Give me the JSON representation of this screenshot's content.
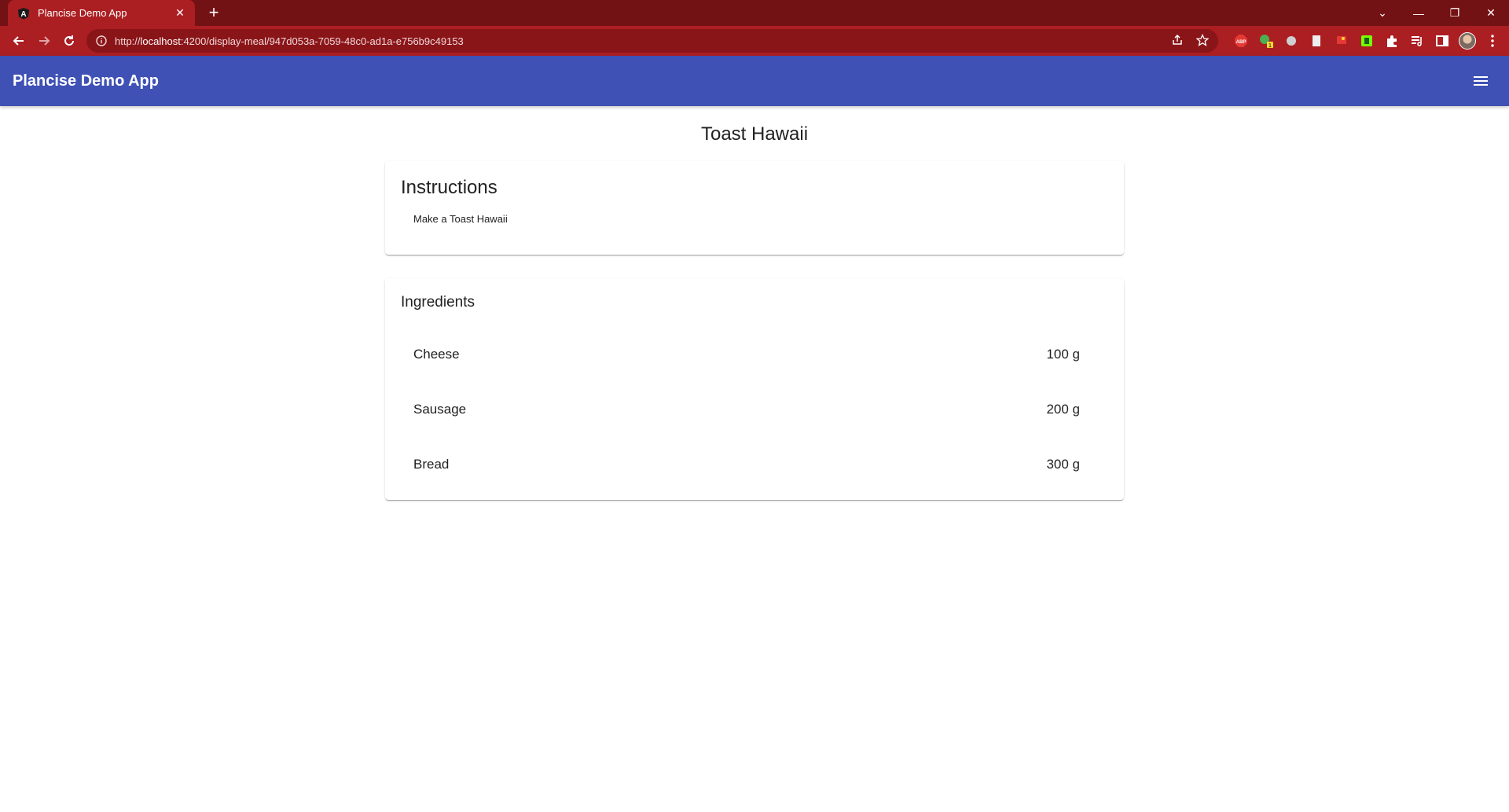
{
  "browser": {
    "tab_title": "Plancise Demo App",
    "url_prefix": "http://",
    "url_host": "localhost",
    "url_path": ":4200/display-meal/947d053a-7059-48c0-ad1a-e756b9c49153",
    "accent_color": "#ab1e22",
    "tabstrip_color": "#731214",
    "extensions": [
      "abp-icon",
      "extension-badge-icon",
      "circle-extension-icon",
      "page-extension-icon",
      "flag-extension-icon",
      "green-extension-icon",
      "puzzle-icon",
      "reading-list-icon",
      "side-panel-icon"
    ]
  },
  "app": {
    "title": "Plancise Demo App",
    "toolbar_color": "#3f51b5"
  },
  "meal": {
    "name": "Toast Hawaii",
    "instructions_heading": "Instructions",
    "instructions_text": "Make a Toast Hawaii",
    "ingredients_heading": "Ingredients",
    "ingredients": [
      {
        "name": "Cheese",
        "amount": "100 g"
      },
      {
        "name": "Sausage",
        "amount": "200 g"
      },
      {
        "name": "Bread",
        "amount": "300 g"
      }
    ]
  }
}
